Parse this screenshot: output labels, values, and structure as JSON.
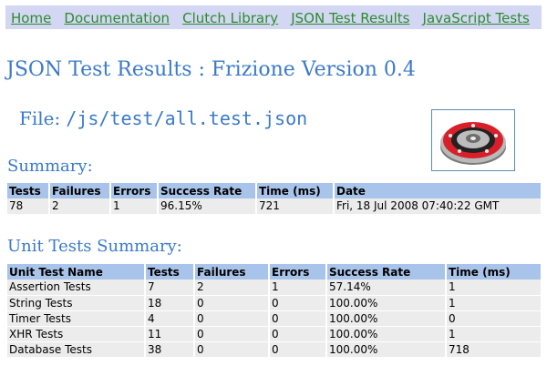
{
  "nav": {
    "links": [
      "Home",
      "Documentation",
      "Clutch Library",
      "JSON Test Results",
      "JavaScript Tests"
    ]
  },
  "page_title": "JSON Test Results : Frizione Version 0.4",
  "file": {
    "label": "File:",
    "path": "/js/test/all.test.json"
  },
  "summary": {
    "title": "Summary:",
    "headers": [
      "Tests",
      "Failures",
      "Errors",
      "Success Rate",
      "Time (ms)",
      "Date"
    ],
    "row": [
      "78",
      "2",
      "1",
      "96.15%",
      "721",
      "Fri, 18 Jul 2008 07:40:22 GMT"
    ]
  },
  "unit_summary": {
    "title": "Unit Tests Summary:",
    "headers": [
      "Unit Test Name",
      "Tests",
      "Failures",
      "Errors",
      "Success Rate",
      "Time (ms)"
    ],
    "rows": [
      [
        "Assertion Tests",
        "7",
        "2",
        "1",
        "57.14%",
        "1"
      ],
      [
        "String Tests",
        "18",
        "0",
        "0",
        "100.00%",
        "1"
      ],
      [
        "Timer Tests",
        "4",
        "0",
        "0",
        "100.00%",
        "0"
      ],
      [
        "XHR Tests",
        "11",
        "0",
        "0",
        "100.00%",
        "1"
      ],
      [
        "Database Tests",
        "38",
        "0",
        "0",
        "100.00%",
        "718"
      ]
    ]
  },
  "colors": {
    "heading": "#3b7ac9",
    "link": "#2e8b2e",
    "nav_bg": "#d3d7f3",
    "table_header": "#a9c4ea",
    "table_cell": "#ececec"
  },
  "logo_icon": "clutch-disc-image"
}
